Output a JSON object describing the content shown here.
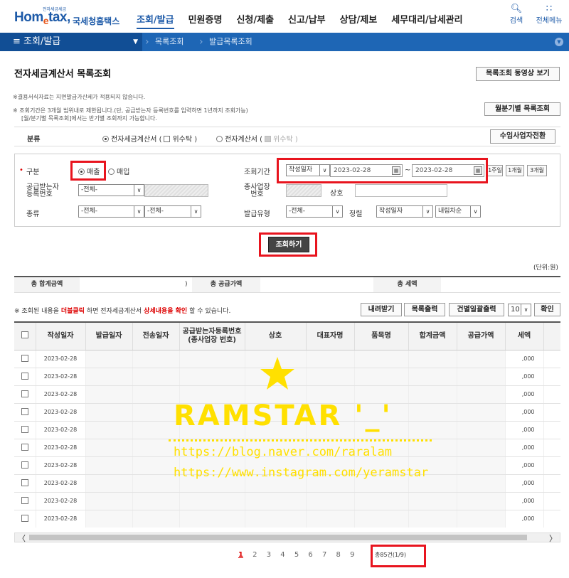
{
  "header": {
    "logo_small": "전자세금세금",
    "logo_main": "Hometax",
    "logo_e": "e",
    "logo_org": "국세청홈택스",
    "menu": [
      "조회/발급",
      "민원증명",
      "신청/제출",
      "신고/납부",
      "상담/제보",
      "세무대리/납세관리"
    ],
    "search_label": "검색",
    "allmenu_label": "전체메뉴"
  },
  "crumbbar": {
    "section": "조회/발급",
    "crumb1": "목록조회",
    "crumb2": "발급목록조회"
  },
  "page": {
    "title": "전자세금계산서 목록조회",
    "video_button": "목록조회 동영상 보기",
    "monthly_button": "월분기별 목록조회",
    "notice1": "※결용서식자료는 지면발급가산세가 적용되지 않습니다.",
    "notice2": "※ 조회기간은 3개월 범위내로 제한됩니다.(단, 공급받는자 등록번호를 입력하면 1년까지 조회가능)",
    "notice3": "[월/분기별 목록조회]에서는 반기별 조회까지 가능합니다."
  },
  "category": {
    "label": "분류",
    "opt1": "전자세금계산서 (",
    "opt1_check": "위수탁 )",
    "opt2": "전자계산서 (",
    "opt2_check": "위수탁 )",
    "switch_button": "수임사업자전환"
  },
  "search": {
    "type_label": "구분",
    "sales": "매출",
    "purchase": "매입",
    "period_label": "조회기간",
    "date_type": "작성일자",
    "date_from": "2023-02-28",
    "date_sep": "~",
    "date_to": "2023-02-28",
    "period_1w": "1주일",
    "period_1m": "1개월",
    "period_3m": "3개월",
    "buyer_label": "공급받는자\n등록번호",
    "buyer_select": "-전체-",
    "branch_label": "종사업장\n번호",
    "company_label": "상호",
    "kind_label": "종류",
    "kind1": "-전체-",
    "kind2": "-전체-",
    "issue_label": "발급유형",
    "issue_value": "-전체-",
    "sort_label": "정렬",
    "sort_field": "작성일자",
    "sort_order": "내림차순",
    "search_button": "조회하기"
  },
  "unit": "(단위:원)",
  "totals": {
    "total_label": "총 합계금액",
    "total_value": ")",
    "supply_label": "총 공급가액",
    "tax_label": "총 세액"
  },
  "list_notice": {
    "prefix": "※ 조회된 내용을",
    "dbl": "더블클릭",
    "middle": "하면 전자세금계산서",
    "detail": "상세내용을 확인",
    "suffix": "할 수 있습니다."
  },
  "toolbar": {
    "download": "내려받기",
    "print_list": "목록출력",
    "print_each": "건별일괄출력",
    "page_size": "10",
    "ok": "확인"
  },
  "table": {
    "columns": [
      "작성일자",
      "발급일자",
      "전송일자",
      "공급받는자등록번호\n(종사업장 번호)",
      "상호",
      "대표자명",
      "품목명",
      "합계금액",
      "공급가액",
      "세액"
    ],
    "rows": [
      {
        "date": "2023-02-28",
        "tax": ",000"
      },
      {
        "date": "2023-02-28",
        "tax": ",000"
      },
      {
        "date": "2023-02-28",
        "tax": ",000"
      },
      {
        "date": "2023-02-28",
        "tax": ",000"
      },
      {
        "date": "2023-02-28",
        "tax": ",000"
      },
      {
        "date": "2023-02-28",
        "tax": ",000"
      },
      {
        "date": "2023-02-28",
        "tax": ",000"
      },
      {
        "date": "2023-02-28",
        "tax": ",000"
      },
      {
        "date": "2023-02-28",
        "tax": ",000"
      },
      {
        "date": "2023-02-28",
        "tax": ",000"
      }
    ]
  },
  "pager": {
    "pages": [
      "1",
      "2",
      "3",
      "4",
      "5",
      "6",
      "7",
      "8",
      "9"
    ],
    "current": "1",
    "total": "총85건(1/9)"
  },
  "watermark": {
    "name": "RAMSTAR '_'",
    "url1": "https://blog.naver.com/raralam",
    "url2": "https://www.instagram.com/yeramstar"
  },
  "colors": {
    "brand_blue": "#1d5aa8",
    "bar_blue": "#1e66b5",
    "highlight_red": "#e8141e",
    "watermark_yellow": "#ffe000"
  }
}
